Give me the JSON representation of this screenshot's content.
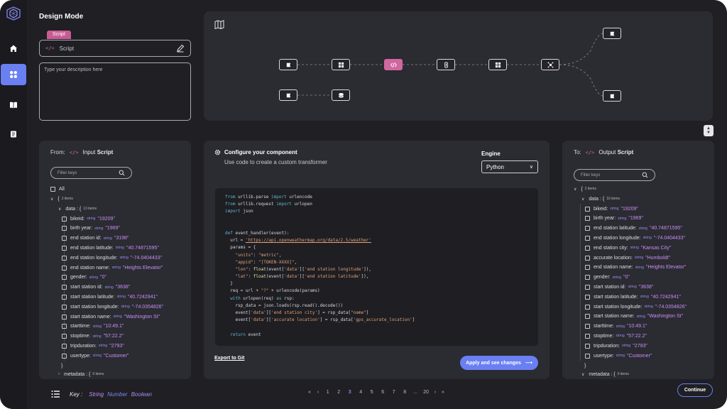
{
  "header": {
    "title": "Design Mode"
  },
  "script_field": {
    "tag": "Script",
    "code_icon": "</>",
    "value": "Script",
    "edit_icon": "pencil-icon"
  },
  "description": {
    "placeholder": "Type your description here"
  },
  "sidebar": {
    "items": [
      "logo",
      "home-icon",
      "components-icon",
      "book-icon",
      "document-icon"
    ],
    "active": "components-icon"
  },
  "flow": {
    "map_icon": "map-icon",
    "nodes": [
      "source",
      "grid",
      "code",
      "transform",
      "grid",
      "split",
      "source",
      "database",
      "source",
      "source"
    ]
  },
  "input_panel": {
    "from_label": "From:",
    "code_icon": "</>",
    "title_prefix": "Input",
    "title_bold": "Script",
    "filter_placeholder": "Filter keys",
    "all_label": "All",
    "root_label": "{",
    "root_count": "2 items",
    "data_label": "data : {",
    "data_count": "13 items",
    "fields": [
      {
        "key": "bikeid:",
        "type": "string",
        "value": "\"19209\""
      },
      {
        "key": "birth year:",
        "type": "string",
        "value": "\"1969\""
      },
      {
        "key": "end station id:",
        "type": "string",
        "value": "\"3198\""
      },
      {
        "key": "end station latitude:",
        "type": "string",
        "value": "\"40.74871595\""
      },
      {
        "key": "end station longitude:",
        "type": "string",
        "value": "\"-74.0404433\""
      },
      {
        "key": "end station name:",
        "type": "string",
        "value": "\"Heights Elevator\""
      },
      {
        "key": "gender:",
        "type": "string",
        "value": "\"0\""
      },
      {
        "key": "start station id:",
        "type": "string",
        "value": "\"3638\""
      },
      {
        "key": "start station latitude:",
        "type": "string",
        "value": "\"40.7242941\""
      },
      {
        "key": "start station longitude:",
        "type": "string",
        "value": "\"-74.0354826\""
      },
      {
        "key": "start station name:",
        "type": "string",
        "value": "\"Washington St\""
      },
      {
        "key": "starttime:",
        "type": "string",
        "value": "\"10:49.1\""
      },
      {
        "key": "stoptime:",
        "type": "string",
        "value": "\"57:22.2\""
      },
      {
        "key": "tripduration:",
        "type": "string",
        "value": "\"2793\""
      },
      {
        "key": "usertype:",
        "type": "string",
        "value": "\"Customer\""
      }
    ],
    "close_brace": "}",
    "metadata_label": "metadata : {",
    "metadata_count": "0 items"
  },
  "config": {
    "title": "Configure your component",
    "subtitle": "Use code to create a custom transformer",
    "engine_label": "Engine",
    "engine_value": "Python",
    "export_label": "Export to Git",
    "apply_label": "Apply and see changes",
    "apply_arrow": "⟶",
    "code_lines": [
      [
        {
          "t": "kw",
          "v": "from"
        },
        {
          "t": "",
          "v": " urllib.parse "
        },
        {
          "t": "kw",
          "v": "import"
        },
        {
          "t": "",
          "v": " urlencode"
        }
      ],
      [
        {
          "t": "kw",
          "v": "from"
        },
        {
          "t": "",
          "v": " urllib.request "
        },
        {
          "t": "kw",
          "v": "import"
        },
        {
          "t": "",
          "v": " urlopen"
        }
      ],
      [
        {
          "t": "kw",
          "v": "import"
        },
        {
          "t": "",
          "v": " json"
        }
      ],
      [],
      [],
      [
        {
          "t": "kw",
          "v": "def"
        },
        {
          "t": "",
          "v": " event_handler(event):"
        }
      ],
      [
        {
          "t": "",
          "v": "  url = "
        },
        {
          "t": "lk",
          "v": "'https://api.openweathermap.org/data/2.5/weather'"
        }
      ],
      [
        {
          "t": "",
          "v": "  params = {"
        }
      ],
      [
        {
          "t": "",
          "v": "    "
        },
        {
          "t": "st",
          "v": "\"units\""
        },
        {
          "t": "",
          "v": ": "
        },
        {
          "t": "st",
          "v": "\"metric\""
        },
        {
          "t": "",
          "v": ","
        }
      ],
      [
        {
          "t": "",
          "v": "    "
        },
        {
          "t": "st",
          "v": "\"appid\""
        },
        {
          "t": "",
          "v": ": "
        },
        {
          "t": "st",
          "v": "\"[TOKEN-XXXX]\""
        },
        {
          "t": "",
          "v": ","
        }
      ],
      [
        {
          "t": "",
          "v": "    "
        },
        {
          "t": "st",
          "v": "\"lon\""
        },
        {
          "t": "",
          "v": ": "
        },
        {
          "t": "fn",
          "v": "float"
        },
        {
          "t": "",
          "v": "(event["
        },
        {
          "t": "st",
          "v": "'data'"
        },
        {
          "t": "",
          "v": "]["
        },
        {
          "t": "st",
          "v": "'end station longitude'"
        },
        {
          "t": "",
          "v": "]),"
        }
      ],
      [
        {
          "t": "",
          "v": "    "
        },
        {
          "t": "st",
          "v": "\"lat\""
        },
        {
          "t": "",
          "v": ": "
        },
        {
          "t": "fn",
          "v": "float"
        },
        {
          "t": "",
          "v": "(event["
        },
        {
          "t": "st",
          "v": "'data'"
        },
        {
          "t": "",
          "v": "]["
        },
        {
          "t": "st",
          "v": "'end station latitude'"
        },
        {
          "t": "",
          "v": "]),"
        }
      ],
      [
        {
          "t": "",
          "v": "  }"
        }
      ],
      [
        {
          "t": "",
          "v": "  req = url + "
        },
        {
          "t": "st",
          "v": "\"?\""
        },
        {
          "t": "",
          "v": " + urlencode(params)"
        }
      ],
      [
        {
          "t": "",
          "v": "  "
        },
        {
          "t": "kw",
          "v": "with"
        },
        {
          "t": "",
          "v": " urlopen(req) "
        },
        {
          "t": "kw",
          "v": "as"
        },
        {
          "t": "",
          "v": " rsp:"
        }
      ],
      [
        {
          "t": "",
          "v": "    rsp_data = json.loads(rsp.read().decode())"
        }
      ],
      [
        {
          "t": "",
          "v": "    event["
        },
        {
          "t": "st",
          "v": "'data'"
        },
        {
          "t": "",
          "v": "]["
        },
        {
          "t": "st",
          "v": "'end station city'"
        },
        {
          "t": "",
          "v": "] = rsp_data["
        },
        {
          "t": "st",
          "v": "\"name\""
        },
        {
          "t": "",
          "v": "]"
        }
      ],
      [
        {
          "t": "",
          "v": "    event["
        },
        {
          "t": "st",
          "v": "'data'"
        },
        {
          "t": "",
          "v": "]["
        },
        {
          "t": "st",
          "v": "'accurate location'"
        },
        {
          "t": "",
          "v": "] = rsp_data["
        },
        {
          "t": "st",
          "v": "'gps_accurate_location'"
        },
        {
          "t": "",
          "v": "]"
        }
      ],
      [],
      [
        {
          "t": "",
          "v": "  "
        },
        {
          "t": "kw",
          "v": "return"
        },
        {
          "t": "",
          "v": " event"
        }
      ]
    ]
  },
  "output_panel": {
    "to_label": "To:",
    "code_icon": "</>",
    "title_prefix": "Output",
    "title_bold": "Script",
    "filter_placeholder": "Filter keys",
    "root_label": "{",
    "root_count": "2 items",
    "data_label": "data : {",
    "data_count": "16 items",
    "fields": [
      {
        "key": "bikeid:",
        "type": "string",
        "value": "\"19209\""
      },
      {
        "key": "birth year:",
        "type": "string",
        "value": "\"1969\""
      },
      {
        "key": "end station latitude:",
        "type": "string",
        "value": "\"40.74871595\""
      },
      {
        "key": "end station longitude:",
        "type": "string",
        "value": "\"-74.0404433\""
      },
      {
        "key": "end station city:",
        "type": "string",
        "value": "\"Kansas City\""
      },
      {
        "key": "accurate location:",
        "type": "string",
        "value": "\"Humboldt\""
      },
      {
        "key": "end station name:",
        "type": "string",
        "value": "\"Heights Elevator\""
      },
      {
        "key": "gender:",
        "type": "string",
        "value": "\"0\""
      },
      {
        "key": "start station id:",
        "type": "string",
        "value": "\"3638\""
      },
      {
        "key": "start station latitude:",
        "type": "string",
        "value": "\"40.7242941\""
      },
      {
        "key": "start station longitude:",
        "type": "string",
        "value": "\"-74.0354826\""
      },
      {
        "key": "start station name:",
        "type": "string",
        "value": "\"Washington St\""
      },
      {
        "key": "starttime:",
        "type": "string",
        "value": "\"10:49.1\""
      },
      {
        "key": "stoptime:",
        "type": "string",
        "value": "\"57:22.2\""
      },
      {
        "key": "tripduration:",
        "type": "string",
        "value": "\"2793\""
      },
      {
        "key": "usertype:",
        "type": "string",
        "value": "\"Customer\""
      }
    ],
    "close_brace": "}",
    "metadata_label": "metadata : {",
    "metadata_count": "0 items"
  },
  "legend": {
    "key_label": "Key :",
    "string_label": "String",
    "number_label": "Number",
    "boolean_label": "Boolean"
  },
  "pagination": {
    "first": "«",
    "prev": "‹",
    "pages": [
      "1",
      "2",
      "3",
      "4",
      "5",
      "6",
      "7",
      "8"
    ],
    "current": "3",
    "ellipsis": "...",
    "last_page": "20",
    "next": "›",
    "last": "»"
  },
  "footer": {
    "continue_label": "Continue"
  },
  "colors": {
    "accent": "#6a7ff2",
    "code_pink": "#d0679f",
    "string_value": "#c98ef5",
    "number": "#7f87f4"
  }
}
